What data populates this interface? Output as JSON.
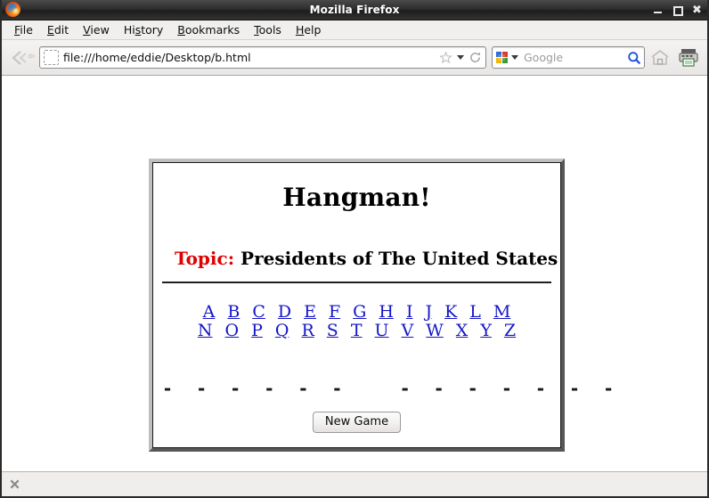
{
  "window": {
    "title": "Mozilla Firefox",
    "app_icon": "firefox-logo-icon",
    "controls": {
      "minimize": "minimize-icon",
      "maximize": "maximize-icon",
      "close": "✖"
    }
  },
  "menubar": {
    "items": [
      {
        "label": "File",
        "accel": "F"
      },
      {
        "label": "Edit",
        "accel": "E"
      },
      {
        "label": "View",
        "accel": "V"
      },
      {
        "label": "History",
        "accel": "s"
      },
      {
        "label": "Bookmarks",
        "accel": "B"
      },
      {
        "label": "Tools",
        "accel": "T"
      },
      {
        "label": "Help",
        "accel": "H"
      }
    ]
  },
  "navbar": {
    "back_forward_icon": "back-forward-arrow-icon",
    "url": {
      "value": "file:///home/eddie/Desktop/b.html",
      "favicon": "dotted-favicon-placeholder-icon",
      "bookmark_icon": "star-icon",
      "dropdown_icon": "chevron-down-icon",
      "reload_icon": "reload-icon"
    },
    "search": {
      "engine_icon": "google-logo-icon",
      "engine_dropdown_icon": "chevron-down-icon",
      "placeholder": "Google",
      "value": "",
      "go_icon": "magnifier-icon"
    },
    "home_icon": "home-icon",
    "print_icon": "print-icon"
  },
  "page": {
    "title": "Hangman!",
    "topic_label": "Topic:",
    "topic_value": "Presidents of The United States",
    "topic_label_color": "#e00000",
    "letters_row1": [
      "A",
      "B",
      "C",
      "D",
      "E",
      "F",
      "G",
      "H",
      "I",
      "J",
      "K",
      "L",
      "M"
    ],
    "letters_row2": [
      "N",
      "O",
      "P",
      "Q",
      "R",
      "S",
      "T",
      "U",
      "V",
      "W",
      "X",
      "Y",
      "Z"
    ],
    "letter_link_color": "#1414c8",
    "word_display": "- - - - - -   - - - - - - -",
    "word_groups": [
      6,
      7
    ],
    "new_game_label": "New Game"
  },
  "statusbar": {
    "close_icon": "close-icon"
  }
}
